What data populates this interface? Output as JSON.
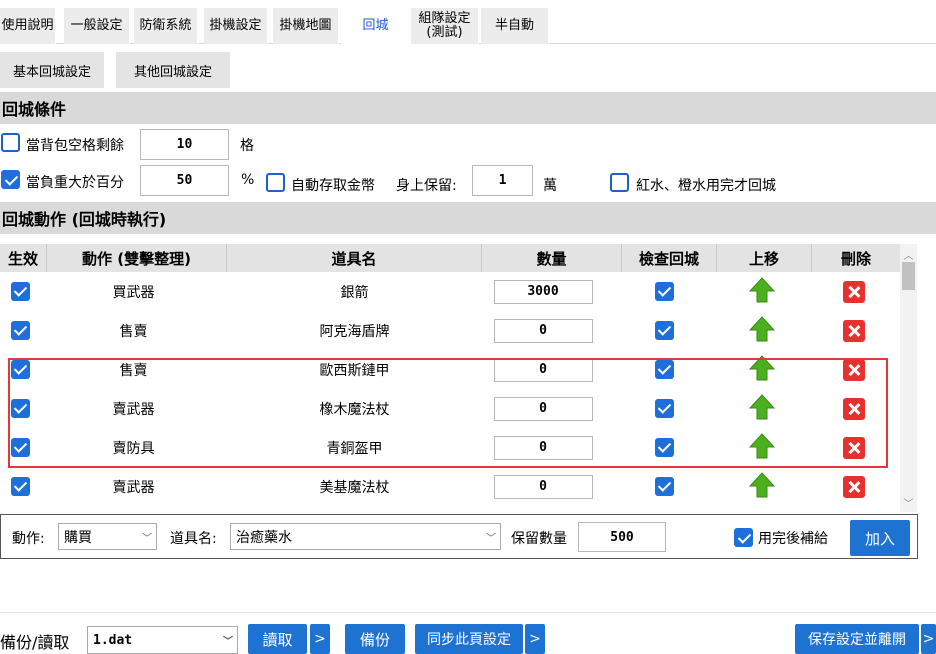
{
  "tabs": [
    {
      "label": "使用說明",
      "active": false
    },
    {
      "label": "一般設定",
      "active": false
    },
    {
      "label": "防衛系統",
      "active": false
    },
    {
      "label": "掛機設定",
      "active": false
    },
    {
      "label": "掛機地圖",
      "active": false
    },
    {
      "label": "回城",
      "active": true
    },
    {
      "label": "組隊設定\n(測試)",
      "active": false
    },
    {
      "label": "半自動",
      "active": false
    }
  ],
  "subtabs": [
    "基本回城設定",
    "其他回城設定"
  ],
  "conditions": {
    "title": "回城條件",
    "bag_slots": {
      "label": "當背包空格剩餘",
      "checked": false,
      "value": "10",
      "unit": "格"
    },
    "weight": {
      "label": "當負重大於百分",
      "checked": true,
      "value": "50",
      "unit": "%"
    },
    "auto_gold": {
      "label": "自動存取金幣",
      "checked": false
    },
    "keep_label": "身上保留:",
    "keep_value": "1",
    "keep_unit": "萬",
    "potion": {
      "label": "紅水、橙水用完才回城",
      "checked": false
    }
  },
  "actions": {
    "title": "回城動作 (回城時執行)",
    "columns": [
      "生效",
      "動作 (雙擊整理)",
      "道具名",
      "數量",
      "檢查回城",
      "上移",
      "刪除"
    ],
    "rows": [
      {
        "active": true,
        "action": "買武器",
        "item": "銀箭",
        "qty": "3000",
        "check": true
      },
      {
        "active": true,
        "action": "售賣",
        "item": "阿克海盾牌",
        "qty": "0",
        "check": true
      },
      {
        "active": true,
        "action": "售賣",
        "item": "歐西斯鏈甲",
        "qty": "0",
        "check": true
      },
      {
        "active": true,
        "action": "賣武器",
        "item": "橡木魔法杖",
        "qty": "0",
        "check": true
      },
      {
        "active": true,
        "action": "賣防具",
        "item": "青銅盔甲",
        "qty": "0",
        "check": true
      },
      {
        "active": true,
        "action": "賣武器",
        "item": "美基魔法杖",
        "qty": "0",
        "check": true
      }
    ]
  },
  "add_panel": {
    "action_label": "動作:",
    "action_value": "購買",
    "item_label": "道具名:",
    "item_value": "治癒藥水",
    "keep_label": "保留數量",
    "keep_value": "500",
    "refill_label": "用完後補給",
    "refill_checked": true,
    "add_button": "加入"
  },
  "footer": {
    "backup_label": "備份/讀取",
    "file_value": "1.dat",
    "read_button": "讀取",
    "arrow": ">",
    "backup_button": "備份",
    "sync_button": "同步此頁設定",
    "save_button": "保存設定並離開"
  },
  "colors": {
    "accent": "#1e73d2",
    "highlight_box": "#e0393a",
    "delete": "#e8312f",
    "arrow_up": "#4caf1d"
  }
}
